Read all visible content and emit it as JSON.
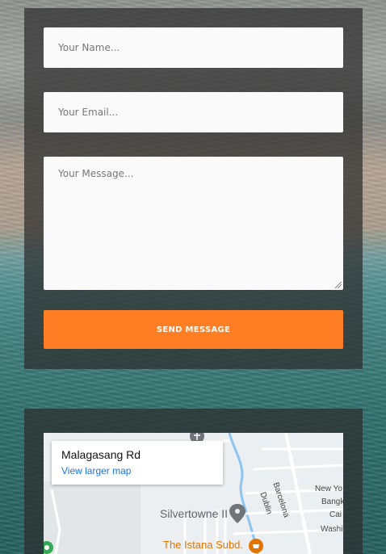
{
  "form": {
    "name_placeholder": "Your Name...",
    "email_placeholder": "Your Email...",
    "message_placeholder": "Your Message...",
    "send_label": "SEND MESSAGE"
  },
  "map": {
    "place_name": "Malagasang Rd",
    "view_larger_label": "View larger map",
    "labels": {
      "silvertowne": "Silvertowne II",
      "istana": "The Istana Subd.",
      "barcelona": "Barcelona",
      "dublin": "Dublin",
      "new_york": "New Yo",
      "bangkok": "Bangk",
      "cairo": "Cai",
      "washington": "Washi"
    }
  },
  "colors": {
    "accent": "#ff7e24",
    "link": "#1a73e8",
    "panel": "rgba(45,45,45,0.72)"
  }
}
